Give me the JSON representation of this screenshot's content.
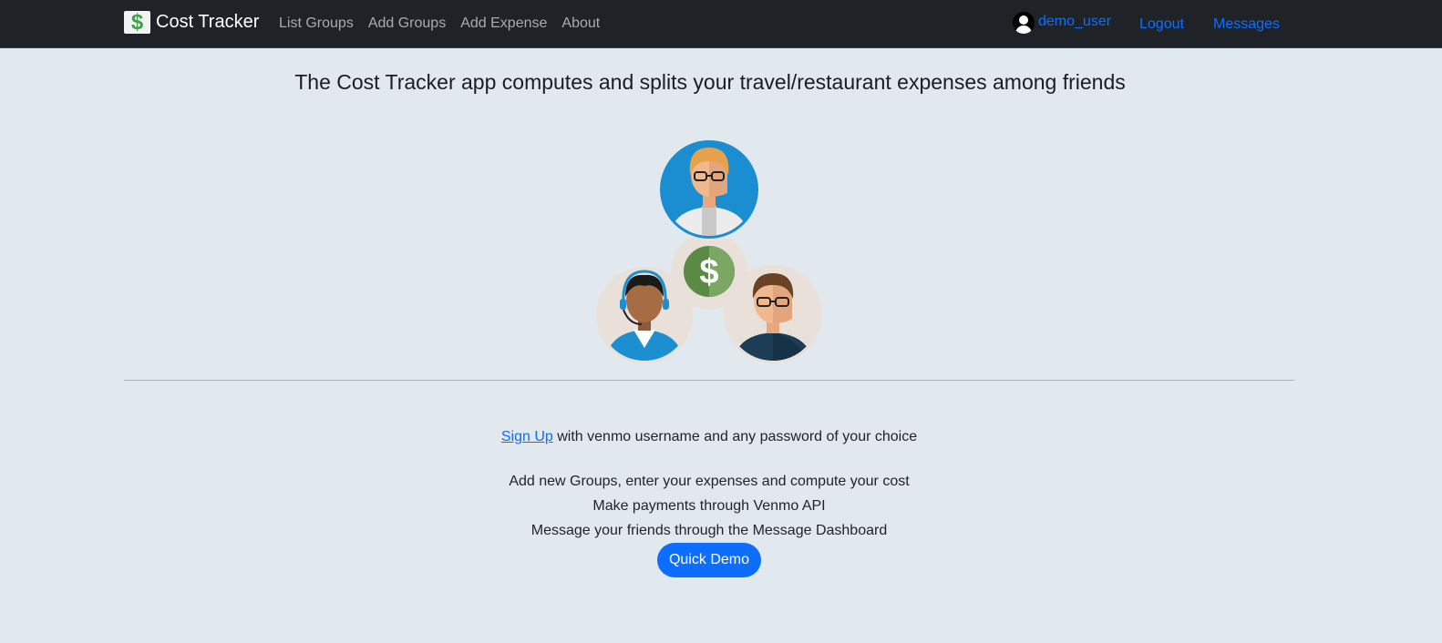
{
  "navbar": {
    "brand_icon": "$",
    "brand_name": "Cost Tracker",
    "links": [
      "List Groups",
      "Add Groups",
      "Add Expense",
      "About"
    ],
    "username": "demo_user",
    "logout": "Logout",
    "messages": "Messages"
  },
  "main": {
    "headline": "The Cost Tracker app computes and splits your travel/restaurant expenses among friends",
    "illustration_dollar": "$",
    "signup_link": "Sign Up",
    "signup_rest": " with venmo username and any password of your choice",
    "features": [
      "Add new Groups, enter your expenses and compute your cost",
      "Make payments through Venmo API",
      "Message your friends through the Message Dashboard"
    ],
    "demo_button": "Quick Demo"
  },
  "colors": {
    "navbar_bg": "#1f2227",
    "page_bg": "#e1e8ee",
    "accent": "#0d6efd",
    "brand_green": "#3aa44a"
  },
  "icons": [
    "dollar-logo-icon",
    "user-avatar-icon",
    "friends-illustration"
  ]
}
